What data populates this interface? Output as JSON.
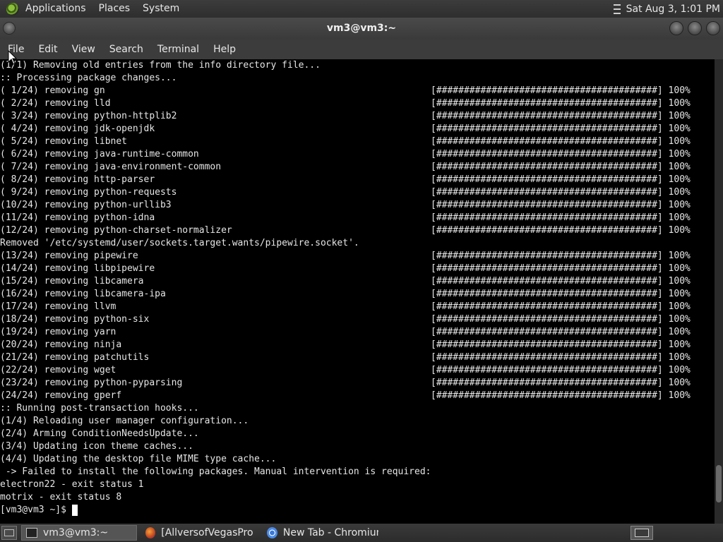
{
  "top_panel": {
    "menus": [
      "Applications",
      "Places",
      "System"
    ],
    "clock": "Sat Aug  3, 1:01 PM"
  },
  "window": {
    "title": "vm3@vm3:~",
    "menubar": [
      "File",
      "Edit",
      "View",
      "Search",
      "Terminal",
      "Help"
    ]
  },
  "terminal": {
    "lines": [
      {
        "text": "(1/1) Removing old entries from the info directory file..."
      },
      {
        "text": ":: Processing package changes..."
      },
      {
        "text": "( 1/24) removing gn",
        "bar": "[########################################] 100%"
      },
      {
        "text": "( 2/24) removing lld",
        "bar": "[########################################] 100%"
      },
      {
        "text": "( 3/24) removing python-httplib2",
        "bar": "[########################################] 100%"
      },
      {
        "text": "( 4/24) removing jdk-openjdk",
        "bar": "[########################################] 100%"
      },
      {
        "text": "( 5/24) removing libnet",
        "bar": "[########################################] 100%"
      },
      {
        "text": "( 6/24) removing java-runtime-common",
        "bar": "[########################################] 100%"
      },
      {
        "text": "( 7/24) removing java-environment-common",
        "bar": "[########################################] 100%"
      },
      {
        "text": "( 8/24) removing http-parser",
        "bar": "[########################################] 100%"
      },
      {
        "text": "( 9/24) removing python-requests",
        "bar": "[########################################] 100%"
      },
      {
        "text": "(10/24) removing python-urllib3",
        "bar": "[########################################] 100%"
      },
      {
        "text": "(11/24) removing python-idna",
        "bar": "[########################################] 100%"
      },
      {
        "text": "(12/24) removing python-charset-normalizer",
        "bar": "[########################################] 100%"
      },
      {
        "text": "Removed '/etc/systemd/user/sockets.target.wants/pipewire.socket'."
      },
      {
        "text": "(13/24) removing pipewire",
        "bar": "[########################################] 100%"
      },
      {
        "text": "(14/24) removing libpipewire",
        "bar": "[########################################] 100%"
      },
      {
        "text": "(15/24) removing libcamera",
        "bar": "[########################################] 100%"
      },
      {
        "text": "(16/24) removing libcamera-ipa",
        "bar": "[########################################] 100%"
      },
      {
        "text": "(17/24) removing llvm",
        "bar": "[########################################] 100%"
      },
      {
        "text": "(18/24) removing python-six",
        "bar": "[########################################] 100%"
      },
      {
        "text": "(19/24) removing yarn",
        "bar": "[########################################] 100%"
      },
      {
        "text": "(20/24) removing ninja",
        "bar": "[########################################] 100%"
      },
      {
        "text": "(21/24) removing patchutils",
        "bar": "[########################################] 100%"
      },
      {
        "text": "(22/24) removing wget",
        "bar": "[########################################] 100%"
      },
      {
        "text": "(23/24) removing python-pyparsing",
        "bar": "[########################################] 100%"
      },
      {
        "text": "(24/24) removing gperf",
        "bar": "[########################################] 100%"
      },
      {
        "text": ":: Running post-transaction hooks..."
      },
      {
        "text": "(1/4) Reloading user manager configuration..."
      },
      {
        "text": "(2/4) Arming ConditionNeedsUpdate..."
      },
      {
        "text": "(3/4) Updating icon theme caches..."
      },
      {
        "text": "(4/4) Updating the desktop file MIME type cache..."
      },
      {
        "text": " -> Failed to install the following packages. Manual intervention is required:"
      },
      {
        "text": "electron22 - exit status 1"
      },
      {
        "text": "motrix - exit status 8"
      }
    ],
    "prompt": "[vm3@vm3 ~]$ ",
    "scroll_position": 0.95,
    "scroll_visible_fraction": 0.08
  },
  "taskbar": {
    "tasks": [
      {
        "label": "vm3@vm3:~",
        "icon": "terminal-icon",
        "active": true
      },
      {
        "label": "[AllversofVegasPro ...",
        "icon": "firefox-icon",
        "active": false
      },
      {
        "label": "New Tab - Chromium",
        "icon": "chromium-icon",
        "active": false
      }
    ]
  }
}
